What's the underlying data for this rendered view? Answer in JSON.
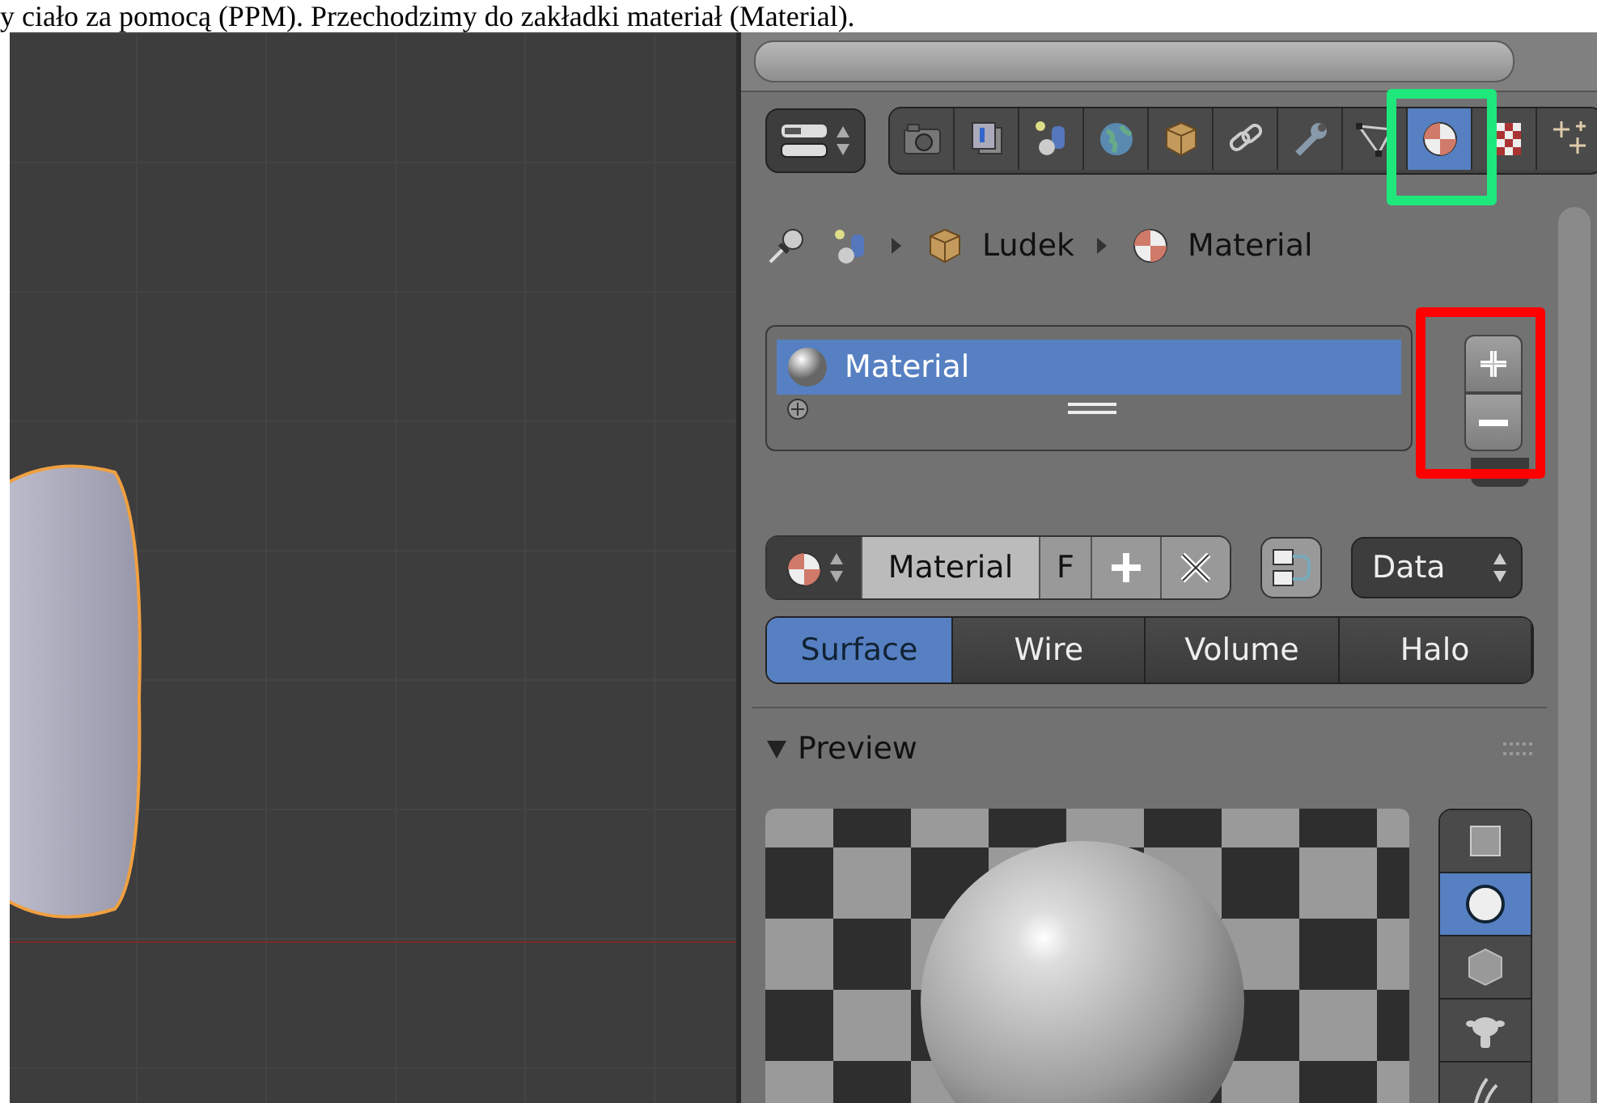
{
  "caption": "y ciało za pomocą (PPM). Przechodzimy do zakładki materiał (Material).",
  "properties": {
    "context_tabs": [
      {
        "kind": "camera",
        "selected": false
      },
      {
        "kind": "layers",
        "selected": false
      },
      {
        "kind": "scene",
        "selected": false
      },
      {
        "kind": "world",
        "selected": false
      },
      {
        "kind": "object",
        "selected": false
      },
      {
        "kind": "constraint",
        "selected": false
      },
      {
        "kind": "modifier",
        "selected": false
      },
      {
        "kind": "mesh",
        "selected": false
      },
      {
        "kind": "material",
        "selected": true
      },
      {
        "kind": "texture",
        "selected": false
      },
      {
        "kind": "particles",
        "selected": false
      }
    ],
    "breadcrumb": [
      {
        "kind": "object",
        "label": "Ludek"
      },
      {
        "kind": "material",
        "label": "Material"
      }
    ],
    "material_slots": [
      {
        "label": "Material",
        "selected": true
      }
    ],
    "material_field": {
      "value": "Material",
      "fake_user": "F"
    },
    "link_dropdown": "Data",
    "type_tabs": [
      {
        "label": "Surface",
        "selected": true
      },
      {
        "label": "Wire",
        "selected": false
      },
      {
        "label": "Volume",
        "selected": false
      },
      {
        "label": "Halo",
        "selected": false
      }
    ],
    "preview_panel": {
      "title": "Preview",
      "expanded": true,
      "shapes": [
        {
          "kind": "plane",
          "selected": false
        },
        {
          "kind": "sphere",
          "selected": true
        },
        {
          "kind": "cube",
          "selected": false
        },
        {
          "kind": "monkey",
          "selected": false
        },
        {
          "kind": "hair",
          "selected": false
        }
      ]
    }
  },
  "annotations": [
    {
      "kind": "tab",
      "color": "#1ee87c"
    },
    {
      "kind": "slot-buttons",
      "color": "#ff0000"
    }
  ]
}
